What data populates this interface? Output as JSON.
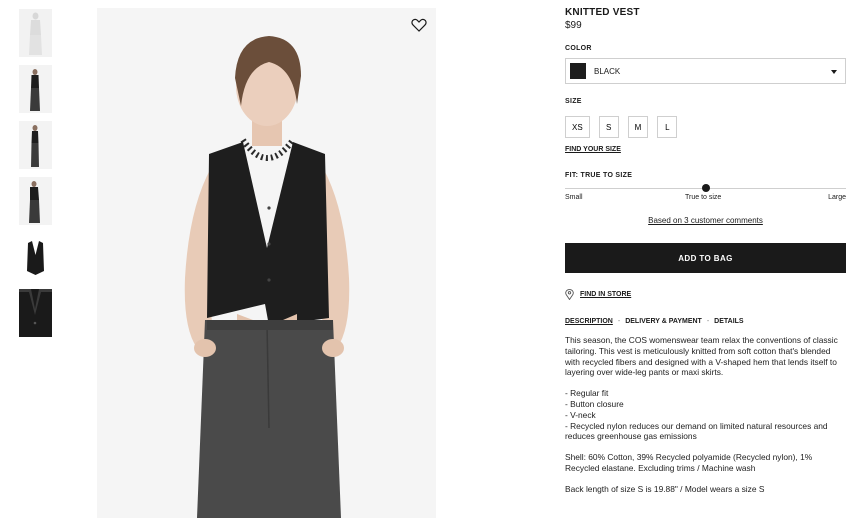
{
  "thumbnails": [
    {
      "name": "thumb-front-light",
      "dark": false
    },
    {
      "name": "thumb-full-body-1",
      "dark": false
    },
    {
      "name": "thumb-full-body-2",
      "dark": false
    },
    {
      "name": "thumb-full-body-3",
      "dark": false
    },
    {
      "name": "thumb-vest-flat",
      "dark": false
    },
    {
      "name": "thumb-detail",
      "dark": true
    }
  ],
  "product": {
    "title": "KNITTED VEST",
    "price": "$99"
  },
  "color": {
    "label": "COLOR",
    "selected": "BLACK",
    "swatch_hex": "#1d1d1d"
  },
  "size": {
    "label": "SIZE",
    "options": [
      "XS",
      "S",
      "M",
      "L"
    ],
    "find_size": "FIND YOUR SIZE"
  },
  "fit": {
    "label": "FIT: TRUE TO SIZE",
    "min": "Small",
    "mid": "True to size",
    "max": "Large",
    "level": 0.5,
    "comments": "Based on 3 customer comments"
  },
  "actions": {
    "add_to_bag": "ADD TO BAG",
    "find_in_store": "FIND IN STORE"
  },
  "tabs": {
    "description": "DESCRIPTION",
    "delivery": "DELIVERY & PAYMENT",
    "details": "DETAILS",
    "separator": "-"
  },
  "description": {
    "intro": "This season, the COS womenswear team relax the conventions of classic tailoring. This vest is meticulously knitted from soft cotton that's blended with recycled fibers and designed with a V-shaped hem that lends itself to layering over wide-leg pants or maxi skirts.",
    "bullets": [
      "- Regular fit",
      "- Button closure",
      "- V-neck",
      "- Recycled nylon reduces our demand on limited natural resources and reduces greenhouse gas emissions"
    ],
    "composition": "Shell: 60% Cotton, 39% Recycled polyamide (Recycled nylon), 1% Recycled elastane. Excluding trims / Machine wash",
    "measurements": "Back length of size S is 19.88\" / Model wears a size S"
  },
  "icons": {
    "wishlist": "heart-icon",
    "store": "location-pin-icon",
    "dropdown": "chevron-down-icon"
  }
}
